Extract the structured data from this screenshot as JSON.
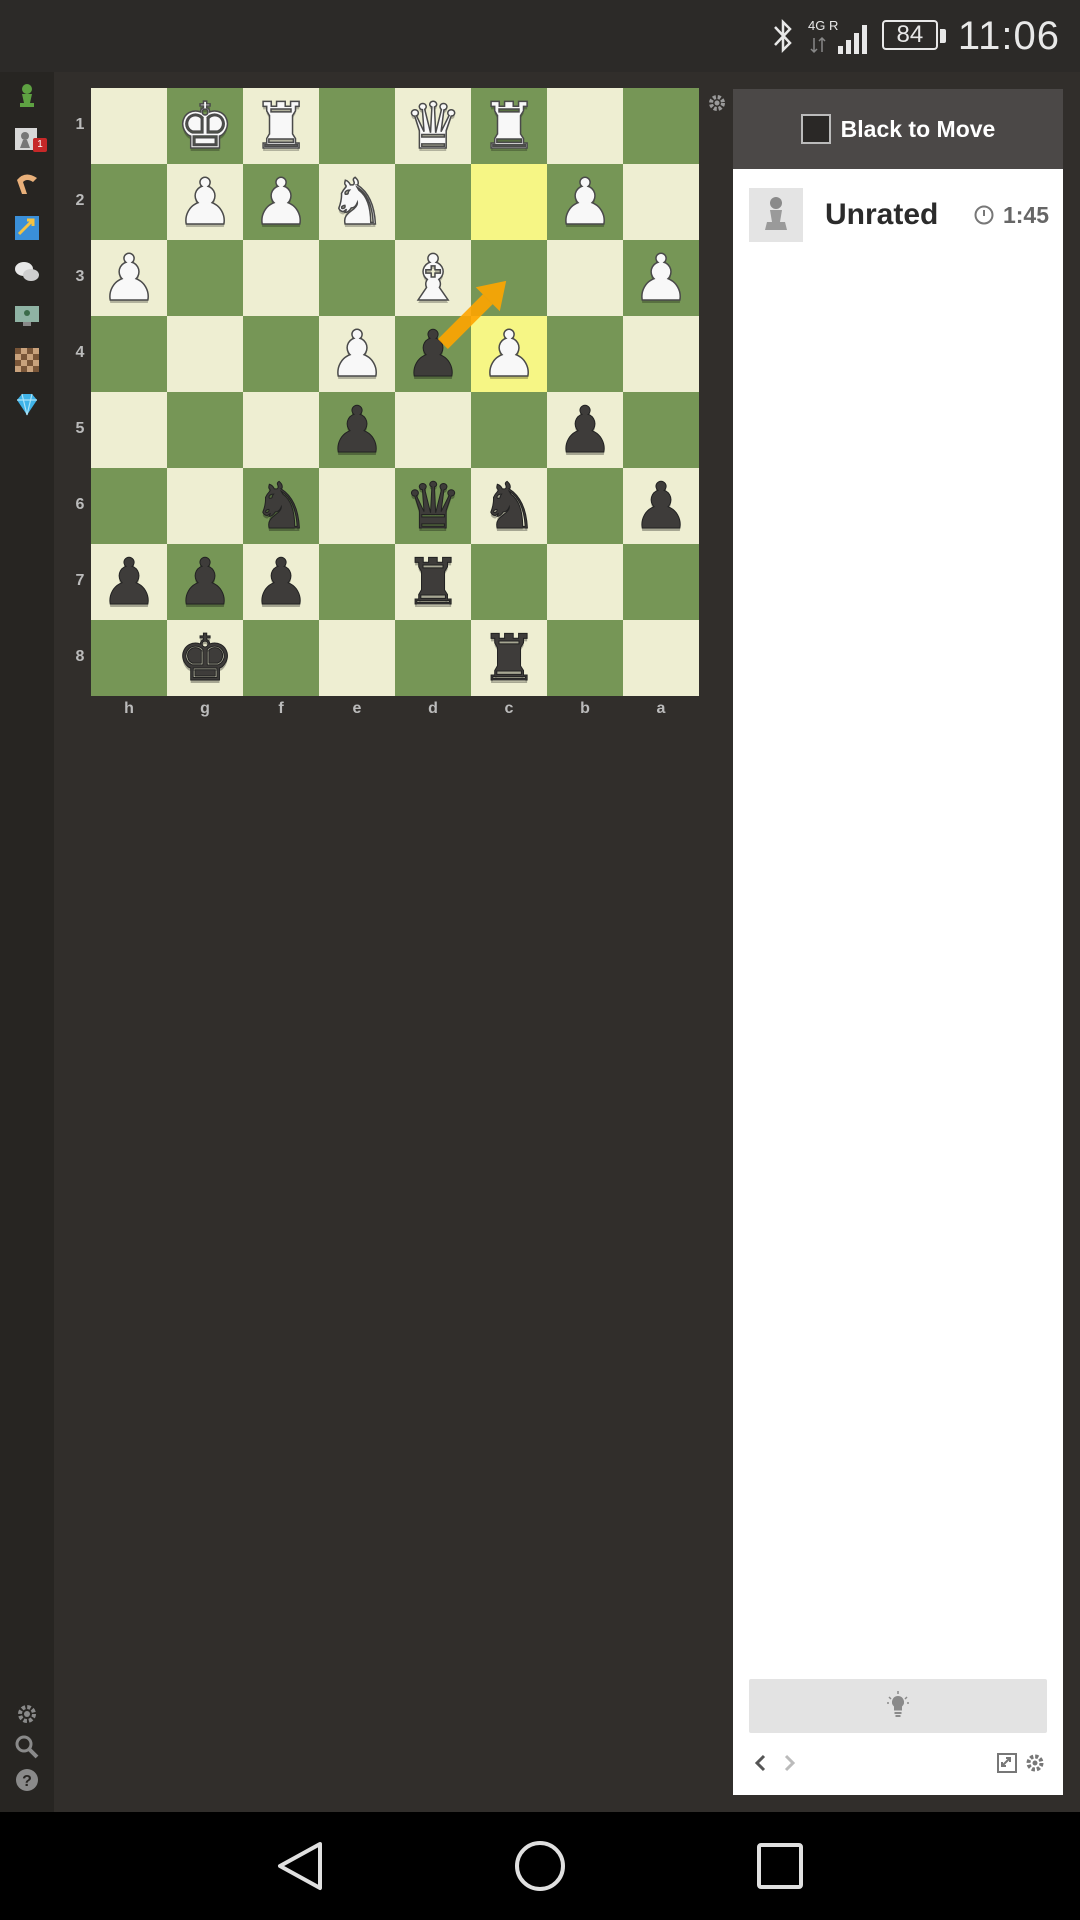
{
  "status_bar": {
    "network_type": "4G R",
    "battery_level": "84",
    "time": "11:06"
  },
  "sidebar": {
    "items": [
      {
        "name": "play-icon"
      },
      {
        "name": "notifications-icon",
        "badge": "1"
      },
      {
        "name": "lessons-icon"
      },
      {
        "name": "puzzles-icon"
      },
      {
        "name": "chat-icon"
      },
      {
        "name": "watch-icon"
      },
      {
        "name": "board-icon"
      },
      {
        "name": "membership-diamond-icon"
      }
    ],
    "bottom_items": [
      {
        "name": "settings-icon"
      },
      {
        "name": "search-icon"
      },
      {
        "name": "help-icon"
      }
    ]
  },
  "board": {
    "orientation": "black",
    "ranks": [
      "1",
      "2",
      "3",
      "4",
      "5",
      "6",
      "7",
      "8"
    ],
    "files": [
      "h",
      "g",
      "f",
      "e",
      "d",
      "c",
      "b",
      "a"
    ],
    "pieces": [
      {
        "sq": "g1",
        "p": "K",
        "c": "w"
      },
      {
        "sq": "f1",
        "p": "R",
        "c": "w"
      },
      {
        "sq": "d1",
        "p": "Q",
        "c": "w"
      },
      {
        "sq": "c1",
        "p": "R",
        "c": "w"
      },
      {
        "sq": "g2",
        "p": "P",
        "c": "w"
      },
      {
        "sq": "f2",
        "p": "P",
        "c": "w"
      },
      {
        "sq": "e2",
        "p": "N",
        "c": "w"
      },
      {
        "sq": "b2",
        "p": "P",
        "c": "w"
      },
      {
        "sq": "h3",
        "p": "P",
        "c": "w"
      },
      {
        "sq": "d3",
        "p": "B",
        "c": "w"
      },
      {
        "sq": "a3",
        "p": "P",
        "c": "w"
      },
      {
        "sq": "e4",
        "p": "P",
        "c": "w"
      },
      {
        "sq": "d4",
        "p": "P",
        "c": "b"
      },
      {
        "sq": "c4",
        "p": "P",
        "c": "w"
      },
      {
        "sq": "e5",
        "p": "P",
        "c": "b"
      },
      {
        "sq": "b5",
        "p": "P",
        "c": "b"
      },
      {
        "sq": "f6",
        "p": "N",
        "c": "b"
      },
      {
        "sq": "d6",
        "p": "Q",
        "c": "b"
      },
      {
        "sq": "c6",
        "p": "N",
        "c": "b"
      },
      {
        "sq": "a6",
        "p": "P",
        "c": "b"
      },
      {
        "sq": "h7",
        "p": "P",
        "c": "b"
      },
      {
        "sq": "g7",
        "p": "P",
        "c": "b"
      },
      {
        "sq": "f7",
        "p": "P",
        "c": "b"
      },
      {
        "sq": "d7",
        "p": "R",
        "c": "b"
      },
      {
        "sq": "g8",
        "p": "K",
        "c": "b"
      },
      {
        "sq": "c8",
        "p": "R",
        "c": "b"
      }
    ],
    "highlighted_squares": [
      "c2",
      "c4"
    ],
    "arrow": {
      "from": "d4",
      "to": "c3",
      "color": "#ffa500"
    },
    "colors": {
      "light": "#eeeed2",
      "dark": "#769656",
      "highlight": "#f6f685"
    }
  },
  "panel": {
    "title": "Black to Move",
    "player": {
      "name": "Unrated",
      "time": "1:45"
    },
    "hint_icon": "lightbulb-icon",
    "controls": [
      "prev-move-icon",
      "next-move-icon",
      "flip-board-icon",
      "panel-settings-icon"
    ]
  },
  "nav_bar": {
    "buttons": [
      "back-icon",
      "home-icon",
      "recents-icon"
    ]
  }
}
